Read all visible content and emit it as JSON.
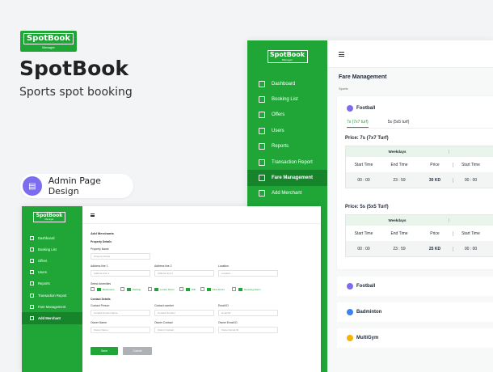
{
  "brand": {
    "logo": "SpotBook",
    "logo_sub": "Manager",
    "title": "SpotBook",
    "subtitle": "Sports spot booking",
    "badge": "Admin Page Design"
  },
  "right_panel": {
    "nav": [
      "Dashboard",
      "Booking List",
      "Offers",
      "Users",
      "Reports",
      "Transaction Report",
      "Fare Management",
      "Add Merchant"
    ],
    "page_title": "Fare Management",
    "section_label": "Sports",
    "sport": "Football",
    "tabs": [
      "7s (7x7 turf)",
      "5s (5x5 turf)"
    ],
    "price1": "Price: 7s (7x7 Turf)",
    "price2": "Price: 5s (5x5 Turf)",
    "weekdays": "Weekdays",
    "cols": [
      "Start Time",
      "End Time",
      "Price",
      "Start Time"
    ],
    "row1": [
      "00 : 00",
      "23 : 59",
      "30 KD",
      "00 : 00"
    ],
    "row2": [
      "00 : 00",
      "23 : 59",
      "25 KD",
      "00 : 00"
    ],
    "other_sports": [
      "Football",
      "Badminton",
      "MultiGym"
    ]
  },
  "left_panel": {
    "nav": [
      "Dashboard",
      "Booking List",
      "Offers",
      "Users",
      "Reports",
      "Transaction Report",
      "Fare Management",
      "Add Merchant"
    ],
    "page_title": "Add Merchants",
    "property_details": "Property Details",
    "property_name": "Property Name",
    "property_name_ph": "Property Name",
    "addr1": "Address line 1",
    "addr1_ph": "Address line 1",
    "addr2": "Address line 2",
    "addr2_ph": "Address line 2",
    "location": "Location",
    "location_ph": "Location",
    "amenities_label": "Select Amenities",
    "amenities": [
      "Restrooms",
      "Parking",
      "Locker Room",
      "Wifi",
      "First Aid kit",
      "Dressing Room"
    ],
    "contact_details": "Contact Details",
    "contact_person": "Contact Person",
    "contact_person_ph": "Contact Person Name",
    "contact_number": "Contact number",
    "contact_number_ph": "Contact Number",
    "email": "Email ID",
    "email_ph": "Email ID",
    "owner_name": "Owner Name",
    "owner_name_ph": "Owner Name",
    "owner_contact": "Owner Contact",
    "owner_contact_ph": "Owner Contact",
    "owner_email": "Owner Email ID",
    "owner_email_ph": "Owner Email ID",
    "save": "Save",
    "cancel": "Cancel"
  }
}
